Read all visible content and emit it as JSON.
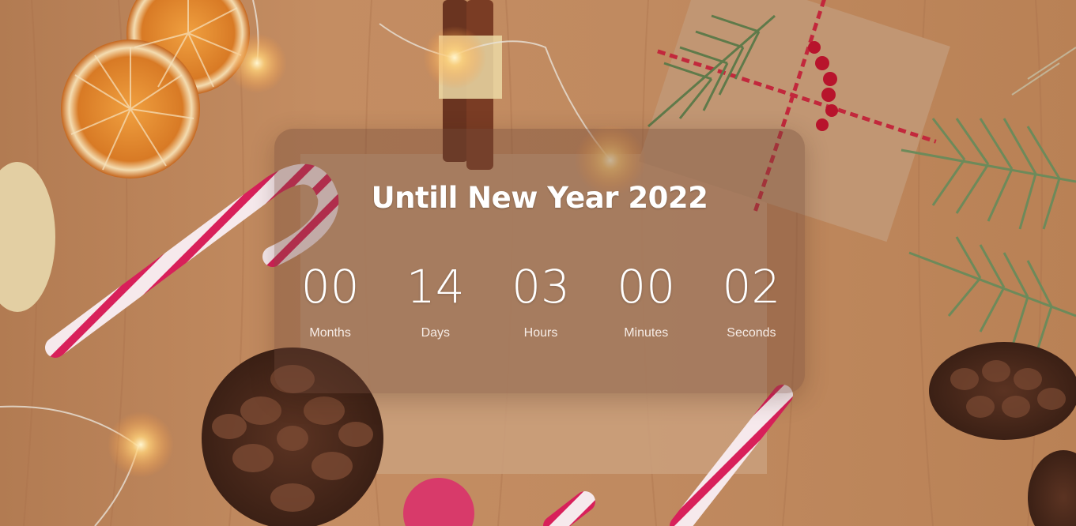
{
  "title": "Untill New Year 2022",
  "countdown": [
    {
      "value": "00",
      "label": "Months"
    },
    {
      "value": "14",
      "label": "Days"
    },
    {
      "value": "03",
      "label": "Hours"
    },
    {
      "value": "00",
      "label": "Minutes"
    },
    {
      "value": "02",
      "label": "Seconds"
    }
  ]
}
